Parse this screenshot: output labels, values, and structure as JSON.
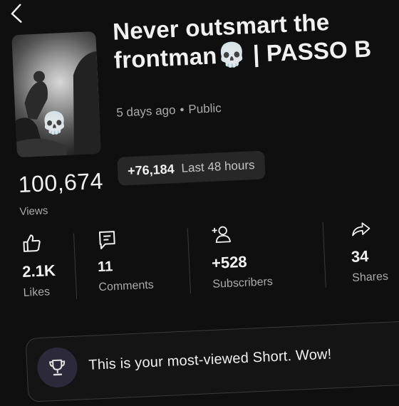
{
  "video": {
    "title": "Never outsmart the\nfrontman💀 | PASSO B",
    "age": "5 days ago",
    "separator": "•",
    "visibility": "Public",
    "thumbnail_overlay": "💀"
  },
  "views": {
    "count": "100,674",
    "label": "Views",
    "delta_value": "+76,184",
    "delta_label": "Last 48 hours"
  },
  "stats": [
    {
      "icon": "thumbs-up-icon",
      "value": "2.1K",
      "label": "Likes"
    },
    {
      "icon": "comment-icon",
      "value": "11",
      "label": "Comments"
    },
    {
      "icon": "add-person-icon",
      "value": "+528",
      "label": "Subscribers"
    },
    {
      "icon": "share-icon",
      "value": "34",
      "label": "Shares"
    }
  ],
  "banner": {
    "icon": "trophy-icon",
    "text": "This is your most-viewed Short. Wow!"
  },
  "colors": {
    "background": "#0f0f0f",
    "text": "#f1f1f1",
    "muted": "#aaaaaa",
    "chip": "#272727",
    "trophy_bg": "#2c2a3a"
  }
}
